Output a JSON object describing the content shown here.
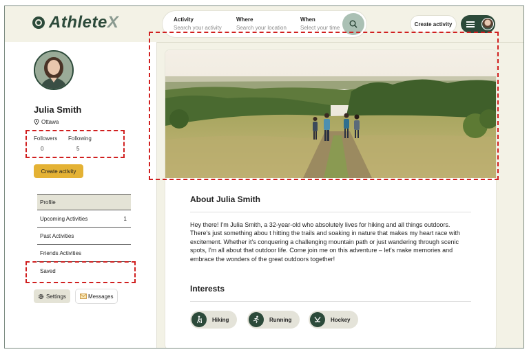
{
  "header": {
    "logo_main": "Athlete",
    "logo_x": "X",
    "search": {
      "activity_label": "Activity",
      "activity_placeholder": "Search your activity",
      "where_label": "Where",
      "where_placeholder": "Search your location",
      "when_label": "When",
      "when_placeholder": "Select your time"
    },
    "create_label": "Create activity"
  },
  "profile": {
    "name": "Julia Smith",
    "location": "Ottawa",
    "followers_label": "Followers",
    "followers_count": "0",
    "following_label": "Following",
    "following_count": "5",
    "create_button": "Create activity"
  },
  "nav": [
    {
      "label": "Profile",
      "badge": ""
    },
    {
      "label": "Upcoming Activities",
      "badge": "1"
    },
    {
      "label": "Past Activities",
      "badge": ""
    },
    {
      "label": "Friends Activities",
      "badge": ""
    },
    {
      "label": "Saved",
      "badge": ""
    }
  ],
  "actions": {
    "settings": "Settings",
    "messages": "Messages"
  },
  "main": {
    "about_title": "About Julia Smith",
    "about_text": "Hey there! I'm Julia Smith, a 32-year-old who absolutely lives for hiking and all things outdoors. There's just something abou t hitting the trails and soaking in nature that makes my heart race with excitement. Whether it's conquering a challenging mountain path or just wandering through scenic spots, I'm all about that outdoor life. Come join me on this adventure – let's make memories and embrace the wonders of the great outdoors together!",
    "interests_title": "Interests",
    "interests": [
      {
        "label": "Hiking",
        "icon": "hiking-icon"
      },
      {
        "label": "Running",
        "icon": "running-icon"
      },
      {
        "label": "Hockey",
        "icon": "hockey-icon"
      }
    ]
  },
  "colors": {
    "brand": "#2c4a3a",
    "accent": "#e4b234",
    "highlight": "#d01f1f",
    "background": "#f3f2e6"
  }
}
